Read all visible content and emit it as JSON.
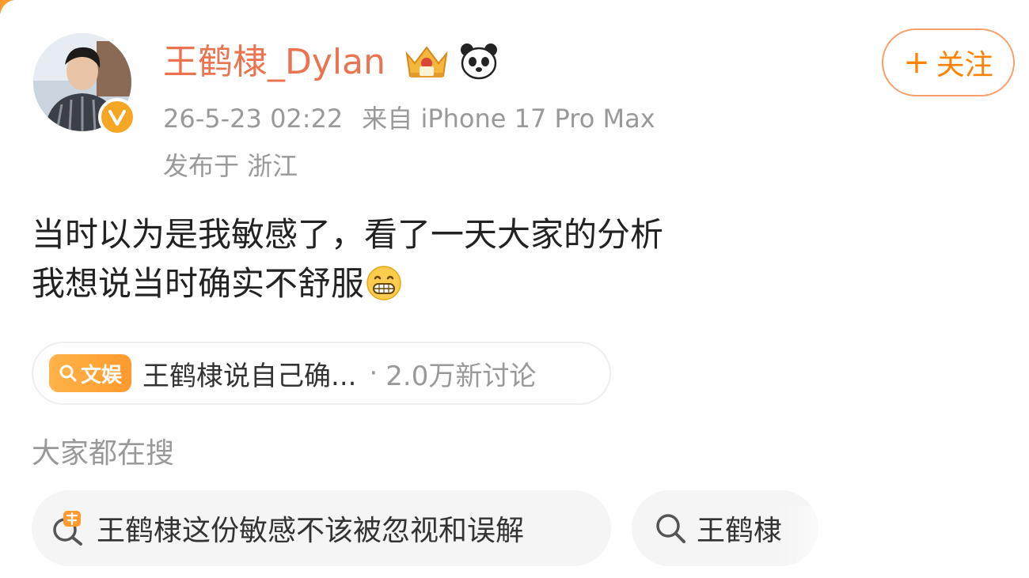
{
  "author": {
    "name": "王鹤棣_Dylan",
    "verified": true,
    "badges": [
      "crown-icon",
      "panda-icon"
    ]
  },
  "meta": {
    "timestamp": "26-5-23 02:22",
    "source": "来自 iPhone 17 Pro Max",
    "location": "发布于 浙江"
  },
  "follow_button": {
    "plus": "+",
    "label": "关注"
  },
  "post": {
    "lines": [
      "当时以为是我敏感了，看了一天大家的分析",
      "我想说当时确实不舒服"
    ],
    "emoji": "grin-emoji"
  },
  "topic": {
    "tag_label": "文娱",
    "title": "王鹤棣说自己确...",
    "separator": "·",
    "count": "2.0万新讨论"
  },
  "search": {
    "heading": "大家都在搜",
    "chips": [
      {
        "label": "王鹤棣这份敏感不该被忽视和误解",
        "icon": "hot-search-icon"
      },
      {
        "label": "王鹤棣",
        "icon": "search-icon"
      }
    ]
  },
  "colors": {
    "username": "#eb7350",
    "follow": "#ff8200",
    "topic_tag": "#ff9a2e",
    "muted_text": "#999999",
    "chip_bg": "#f5f5f5"
  }
}
